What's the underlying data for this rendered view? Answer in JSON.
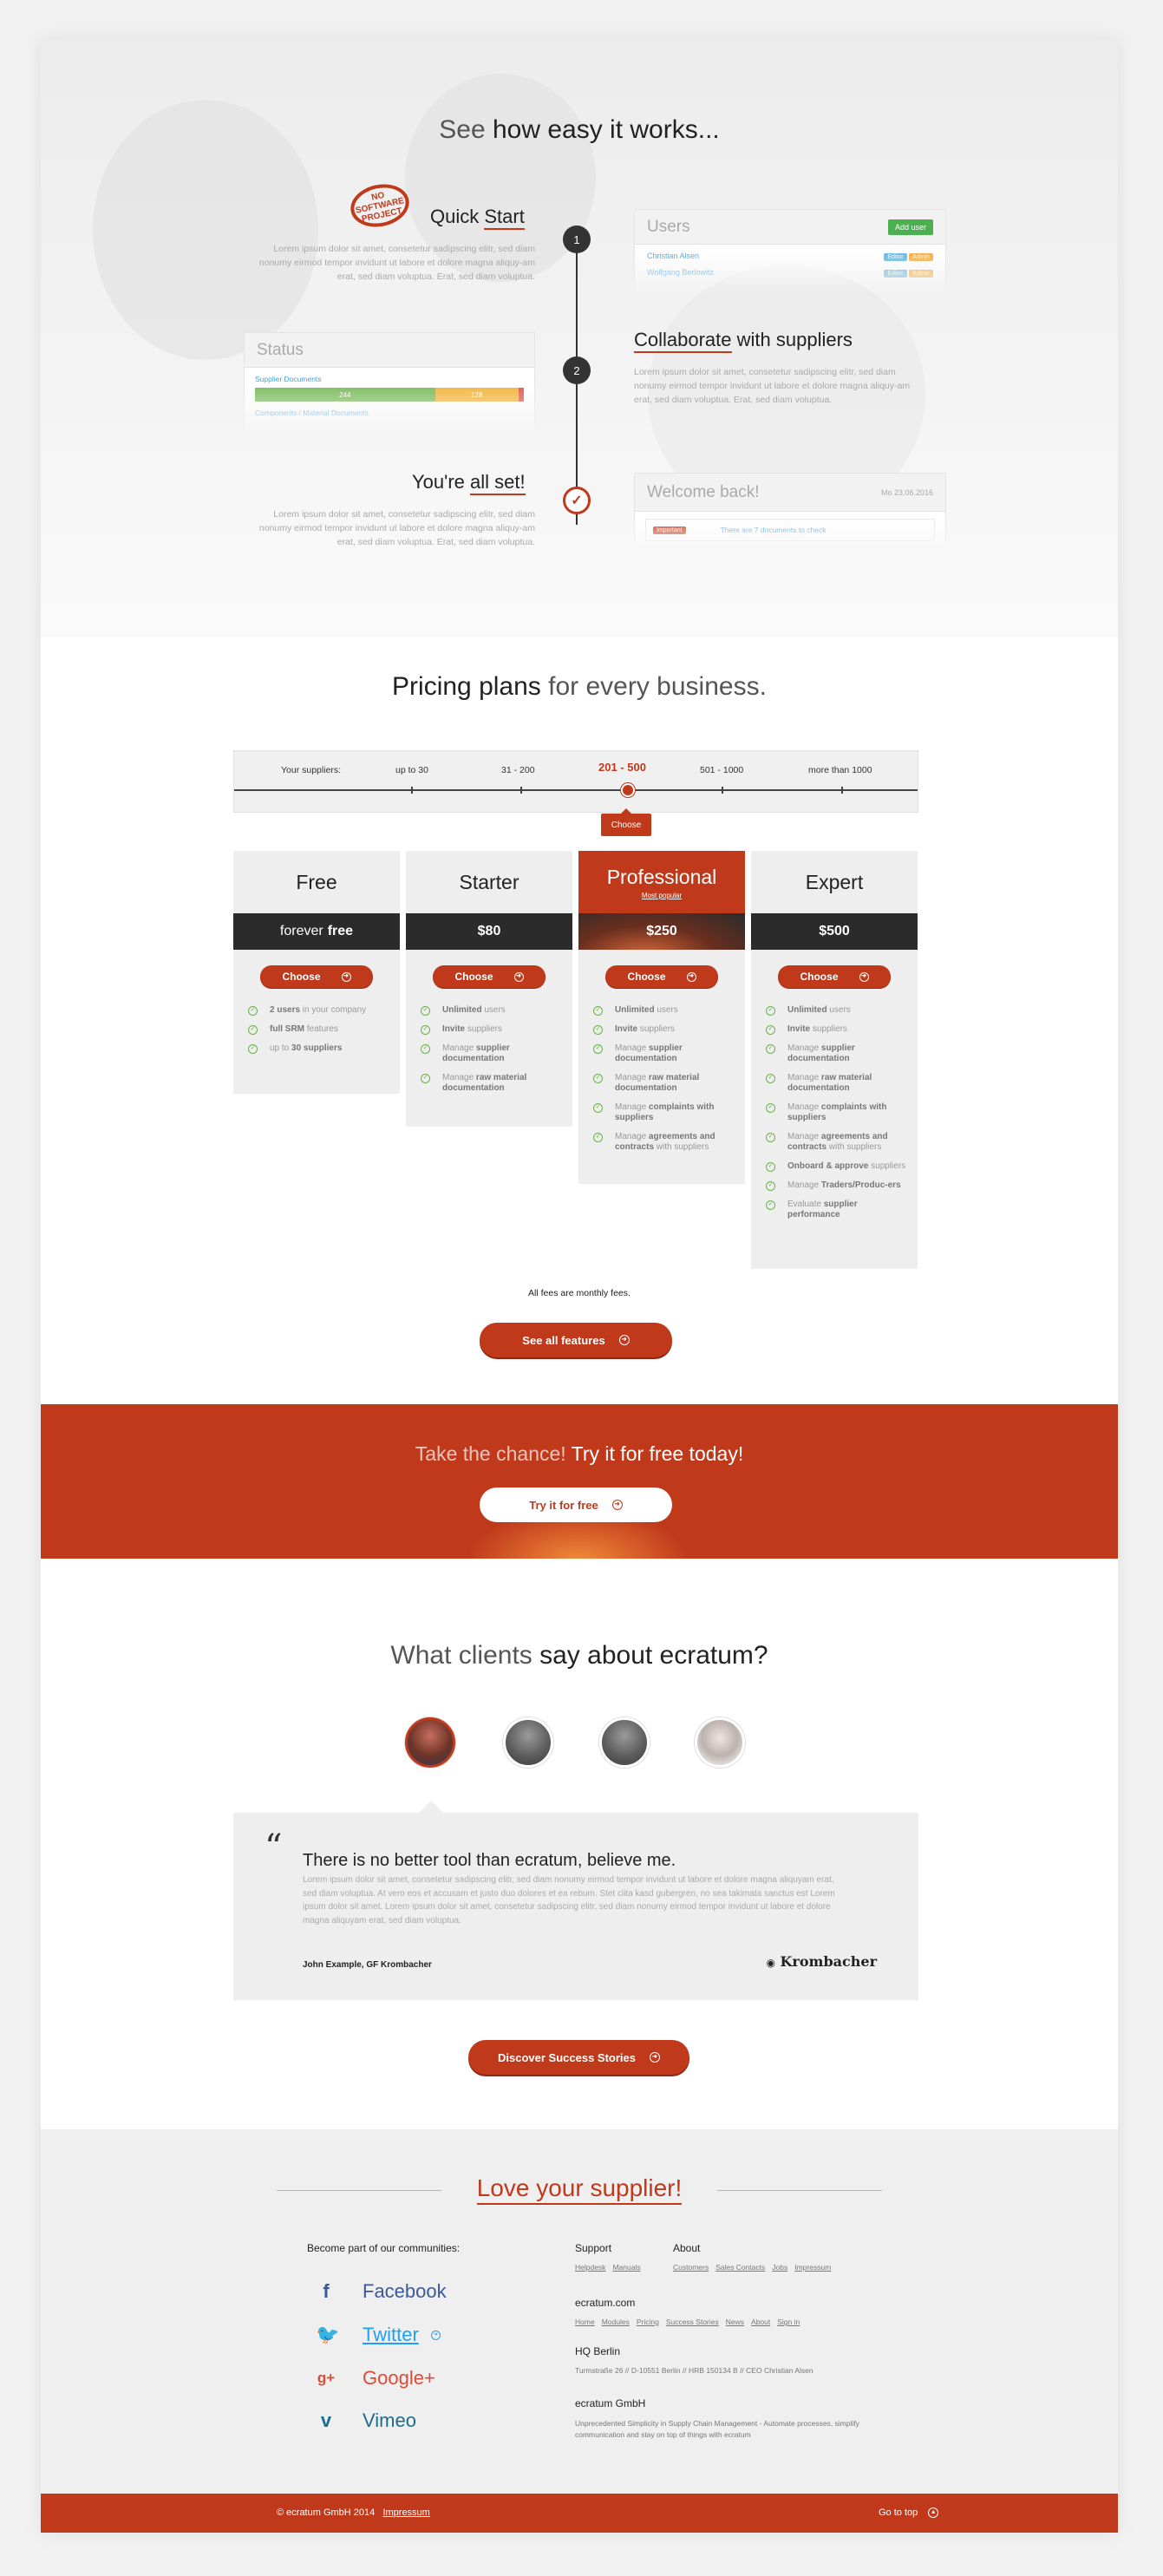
{
  "how": {
    "title_light": "See",
    "title_bold": "how easy it works...",
    "step1": {
      "logo": "NO SOFTWARE PROJECT",
      "title_a": "Quick ",
      "title_b": "Start",
      "text": "Lorem ipsum dolor sit amet, consetetur sadipscing elitr, sed diam nonumy eirmod tempor invidunt ut labore et dolore magna aliquy-am erat, sed diam voluptua. Erat, sed diam voluptua.",
      "number": "1"
    },
    "step2": {
      "title_a": "Collaborate",
      "title_b": " with suppliers",
      "text": "Lorem ipsum dolor sit amet, consetetur sadipscing elitr, sed diam nonumy eirmod tempor invidunt ut labore et dolore magna aliquy-am erat, sed diam voluptua. Erat, sed diam voluptua.",
      "number": "2"
    },
    "step3": {
      "title_a": "You're ",
      "title_b": "all set!",
      "text": "Lorem ipsum dolor sit amet, consetetur sadipscing elitr, sed diam nonumy eirmod tempor invidunt ut labore et dolore magna aliquy-am erat, sed diam voluptua. Erat, sed diam voluptua."
    },
    "users_mock": {
      "title": "Users",
      "add_label": "Add user",
      "user1": "Christian Alsen",
      "user2": "Wolfgang Berlowitz",
      "tag1": "Editor",
      "tag2": "Admin"
    },
    "status_mock": {
      "title": "Status",
      "label1": "Supplier Documents",
      "val_green": "244",
      "val_yellow": "128",
      "label2": "Components / Material Documents",
      "green_pct": 67,
      "yellow_pct": 31
    },
    "welcome_mock": {
      "title": "Welcome back!",
      "date": "Mo 23.06.2016",
      "badge": "Important",
      "msg": "There are 7 documents to check"
    }
  },
  "pricing": {
    "title_bold": "Pricing plans",
    "title_light": " for every business.",
    "slider": {
      "label": "Your suppliers:",
      "options": [
        "up to 30",
        "31 - 200",
        "201 - 500",
        "501 - 1000",
        "more than 1000"
      ],
      "selected": "201 - 500",
      "tip": "Choose"
    },
    "plans": [
      {
        "name": "Free",
        "price_light": "forever",
        "price_bold": "free",
        "button": "Choose",
        "features": [
          [
            "",
            "2 users",
            " in your company"
          ],
          [
            "",
            "full SRM",
            " features"
          ],
          [
            "up to ",
            "30 suppliers",
            ""
          ]
        ]
      },
      {
        "name": "Starter",
        "price_bold": "$80",
        "button": "Choose",
        "features": [
          [
            "",
            "Unlimited",
            " users"
          ],
          [
            "",
            "Invite",
            " suppliers"
          ],
          [
            "Manage ",
            "supplier documentation",
            ""
          ],
          [
            "Manage ",
            "raw material documentation",
            ""
          ]
        ]
      },
      {
        "name": "Professional",
        "badge": "Most popular",
        "price_bold": "$250",
        "button": "Choose",
        "features": [
          [
            "",
            "Unlimited",
            " users"
          ],
          [
            "",
            "Invite",
            " suppliers"
          ],
          [
            "Manage ",
            "supplier documentation",
            ""
          ],
          [
            "Manage ",
            "raw material documentation",
            ""
          ],
          [
            "Manage ",
            "complaints with suppliers",
            ""
          ],
          [
            "Manage ",
            "agreements and contracts",
            " with suppliers"
          ]
        ]
      },
      {
        "name": "Expert",
        "price_bold": "$500",
        "button": "Choose",
        "features": [
          [
            "",
            "Unlimited",
            " users"
          ],
          [
            "",
            "Invite",
            " suppliers"
          ],
          [
            "Manage ",
            "supplier documentation",
            ""
          ],
          [
            "Manage ",
            "raw material documentation",
            ""
          ],
          [
            "Manage ",
            "complaints with suppliers",
            ""
          ],
          [
            "Manage ",
            "agreements and contracts",
            " with suppliers"
          ],
          [
            "",
            "Onboard & approve",
            " suppliers"
          ],
          [
            "Manage ",
            "Traders/Produc-ers",
            ""
          ],
          [
            "Evaluate ",
            "supplier performance",
            ""
          ]
        ]
      }
    ],
    "note": "All fees are monthly fees.",
    "all_features": "See all features"
  },
  "cta": {
    "light": "Take the chance!",
    "bold": " Try it for free today!",
    "button": "Try it for free"
  },
  "clients": {
    "title_light": "What clients",
    "title_bold": " say about ecratum?",
    "quote_title": "There is no better tool than ecratum, believe me.",
    "quote_text": "Lorem ipsum dolor sit amet, consetetur sadipscing elitr, sed diam nonumy eirmod tempor invidunt ut labore et dolore magna aliquyam erat, sed diam voluptua. At vero eos et accusam et justo duo dolores et ea rebum. Stet clita kasd gubergren, no sea takimata sanctus est Lorem ipsum dolor sit amet. Lorem ipsum dolor sit amet, consetetur sadipscing elitr, sed diam nonumy eirmod tempor invidunt ut labore et dolore magna aliquyam erat, sed diam voluptua.",
    "author": "John Example, GF Krombacher",
    "brand": "Krombacher",
    "button": "Discover Success Stories"
  },
  "footer": {
    "love": "Love your supplier!",
    "communities": "Become part of our communities:",
    "social": [
      "Facebook",
      "Twitter",
      "Google+",
      "Vimeo"
    ],
    "support_title": "Support",
    "support_links": [
      "Helpdesk",
      "Manuals"
    ],
    "about_title": "About",
    "about_links": [
      "Customers",
      "Sales Contacts",
      "Jobs",
      "Impressum"
    ],
    "site_title": "ecratum.com",
    "site_links": [
      "Home",
      "Modules",
      "Pricing",
      "Success Stories",
      "News",
      "About",
      "Sign in"
    ],
    "hq_title": "HQ Berlin",
    "hq_text": "Turmstraße 26 // D-10551 Berlin // HRB 150134 B // CEO Christian Alsen",
    "gmbh_title": "ecratum GmbH",
    "gmbh_text": "Unprecedented Simplicity in Supply Chain Management - Automate processes, simplify communication and stay on top of things with ecratum",
    "copyright": "© ecratum GmbH 2014",
    "impressum": "Impressum",
    "top": "Go to top"
  },
  "colors": {
    "accent": "#c0391b",
    "dark": "#2b2b2b",
    "check": "#6ab04c",
    "facebook": "#3b5998",
    "twitter": "#1da1f2",
    "google": "#dd4b39",
    "vimeo": "#1a6f8b"
  }
}
